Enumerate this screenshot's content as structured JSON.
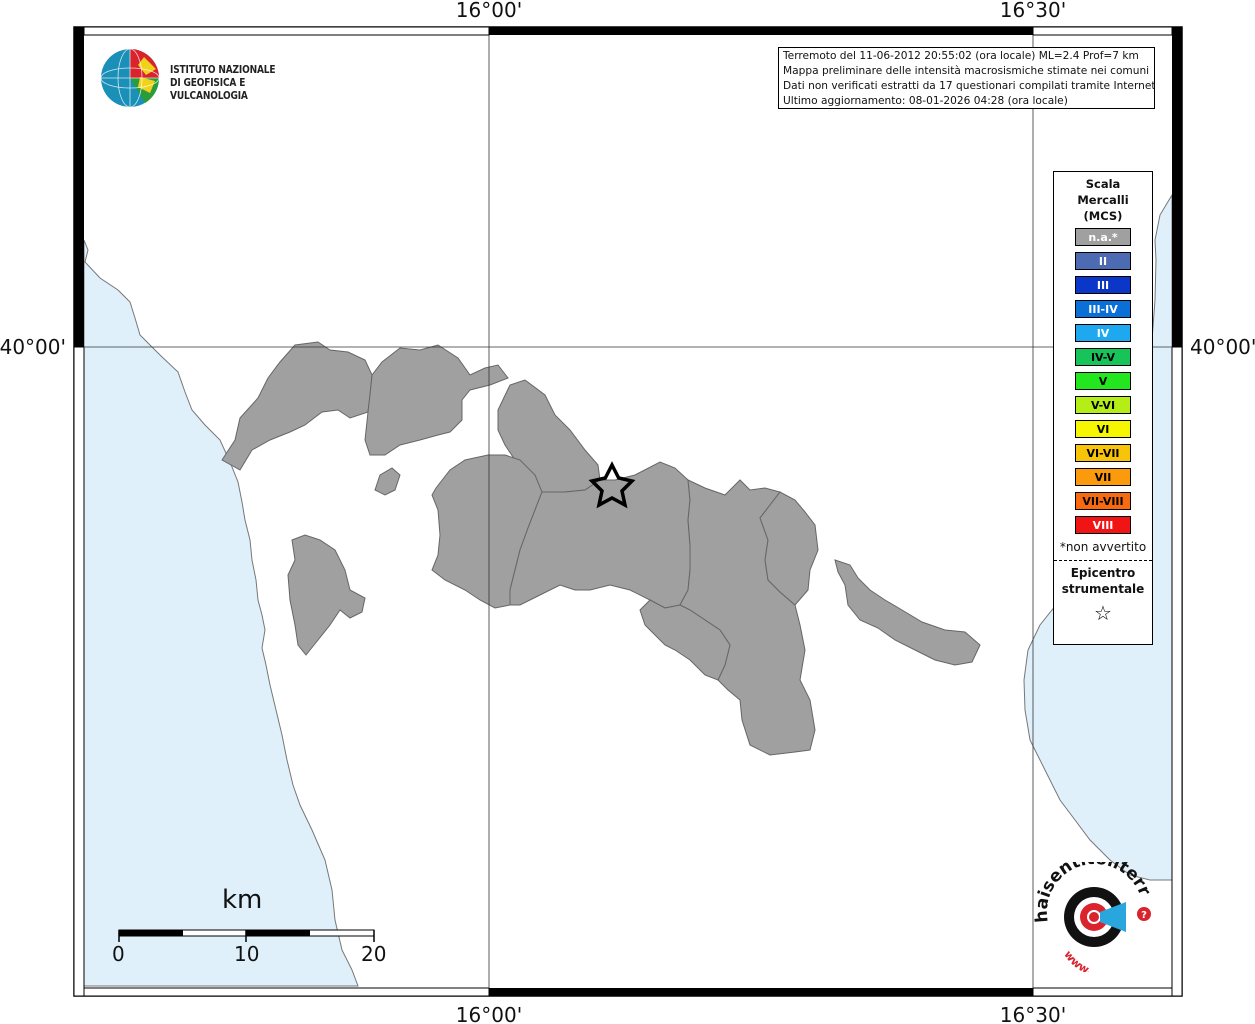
{
  "info": {
    "line1": "Terremoto del 11-06-2012 20:55:02 (ora locale) ML=2.4 Prof=7 km",
    "line2": "Mappa preliminare delle intensità macrosismiche stimate nei comuni",
    "line3": "Dati non verificati estratti da 17 questionari compilati tramite Internet.",
    "line4": "Ultimo aggiornamento: 08-01-2026 04:28 (ora locale)"
  },
  "logo": {
    "line1": "ISTITUTO NAZIONALE",
    "line2": "DI GEOFISICA E VULCANOLOGIA"
  },
  "coords": {
    "top_left": "16°00'",
    "top_right": "16°30'",
    "bottom_left": "16°00'",
    "bottom_right": "16°30'",
    "left": "40°00'",
    "right": "40°00'"
  },
  "legend": {
    "title1": "Scala",
    "title2": "Mercalli",
    "title3": "(MCS)",
    "items": [
      {
        "label": "n.a.*",
        "color": "#a0a0a0",
        "text_color": "#ffffff"
      },
      {
        "label": "II",
        "color": "#4d6bb3",
        "text_color": "#ffffff"
      },
      {
        "label": "III",
        "color": "#0a37c8",
        "text_color": "#ffffff"
      },
      {
        "label": "III-IV",
        "color": "#0a6fd6",
        "text_color": "#ffffff"
      },
      {
        "label": "IV",
        "color": "#1ea8f0",
        "text_color": "#ffffff"
      },
      {
        "label": "IV-V",
        "color": "#16c45a",
        "text_color": "#000000"
      },
      {
        "label": "V",
        "color": "#22e61e",
        "text_color": "#000000"
      },
      {
        "label": "V-VI",
        "color": "#b4ee16",
        "text_color": "#000000"
      },
      {
        "label": "VI",
        "color": "#f6f600",
        "text_color": "#000000"
      },
      {
        "label": "VI-VII",
        "color": "#f8c40a",
        "text_color": "#000000"
      },
      {
        "label": "VII",
        "color": "#fb9a0c",
        "text_color": "#000000"
      },
      {
        "label": "VII-VIII",
        "color": "#f76a10",
        "text_color": "#000000"
      },
      {
        "label": "VIII",
        "color": "#f01414",
        "text_color": "#ffffff"
      }
    ],
    "note": "*non avvertito",
    "epicentro1": "Epicentro",
    "epicentro2": "strumentale",
    "star": "☆"
  },
  "scale_bar": {
    "unit": "km",
    "tick0": "0",
    "tick10": "10",
    "tick20": "20"
  },
  "hst_logo": {
    "text": "haisentitoilterremoto.it",
    "www": "www."
  },
  "colors": {
    "sea": "#dff0fb",
    "land": "#ffffff",
    "municipality": "#a0a0a0"
  }
}
